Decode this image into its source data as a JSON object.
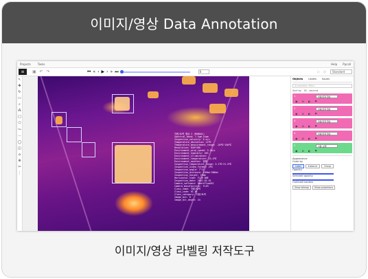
{
  "banner": {
    "title": "이미지/영상 Data Annotation"
  },
  "caption": {
    "text": "이미지/영상 라벨링 저작도구"
  },
  "app": {
    "menu": [
      "Projects",
      "Tasks"
    ],
    "right": [
      "Help",
      "Ppcall"
    ],
    "filename": "CLIP_THERM_THERMAL_20210824_SAMPLE_FRAME_0001.JPG",
    "frame": "0",
    "view_select": "Standard",
    "right_tools": [
      "Fullscreen",
      "Info"
    ]
  },
  "panel": {
    "tabs": [
      "Objects",
      "Labels",
      "Issues"
    ],
    "search_placeholder": "Annotation filter",
    "sort_label": "Sort by",
    "sort_value": "ID - ascend",
    "objects": [
      {
        "id": "1",
        "label": "차량/트럭 형상",
        "color": "#f06bb4"
      },
      {
        "id": "2",
        "label": "차량/트럭 형상",
        "color": "#f06bb4"
      },
      {
        "id": "3",
        "label": "차량/트럭 형상",
        "color": "#f06bb4"
      },
      {
        "id": "4",
        "label": "차량/트럭 형상",
        "color": "#f06bb4"
      },
      {
        "id": "5",
        "label": "사람_보행",
        "color": "#6cd98c"
      }
    ],
    "appearance": {
      "title": "Appearance",
      "color_by_label": "Color by",
      "color_by": [
        "Label",
        "Instance",
        "Group"
      ],
      "opacity_label": "Opacity",
      "selected_opacity_label": "Selected opacity",
      "outlined_label": "Outlined borders",
      "buttons": [
        "Show bitmap",
        "Show projections"
      ]
    }
  },
  "metadata_overlay": "차량/트럭 형상 2 (MANUAL)\nSpectral_band: 7.5μm-14μm\nInspection_velocity: 0 m/s\nTemperature_deviation: ±2℃\nTemperature_measurement_range: -20℃~150℃\nResolution: 640*480\nEnvironment_wind_speed: 3.3m/s\nEnvironment_humidity: 40%\nEnvironment_illuminance:\nEnvironment_temperature: 15.4℃\nEnvironment_weather: 맑음\nInspection_temperature_range: 5.1℃~21.5℃\nInspection_video_format: JPG\nInspection_angle: 7°11'\nInspection_distance: 100km~300km\nInspection_height: 150m\nHorizontal_time: FLIR ONE\nInspection_date: 2021.02.01\nCamera_software: SmartFlowDSC\nCamera_manufacturer: FLIR\nClass_name: 차량/트럭\nClass_code: 01-01\nClass_category: 차량/트럭\nImage_bit: 8\nImage_bit_depth: 24",
  "colors": {
    "banner": "#4e4e4e",
    "object_pink": "#f06bb4",
    "object_green": "#6cd98c",
    "accent": "#3b56f0"
  }
}
